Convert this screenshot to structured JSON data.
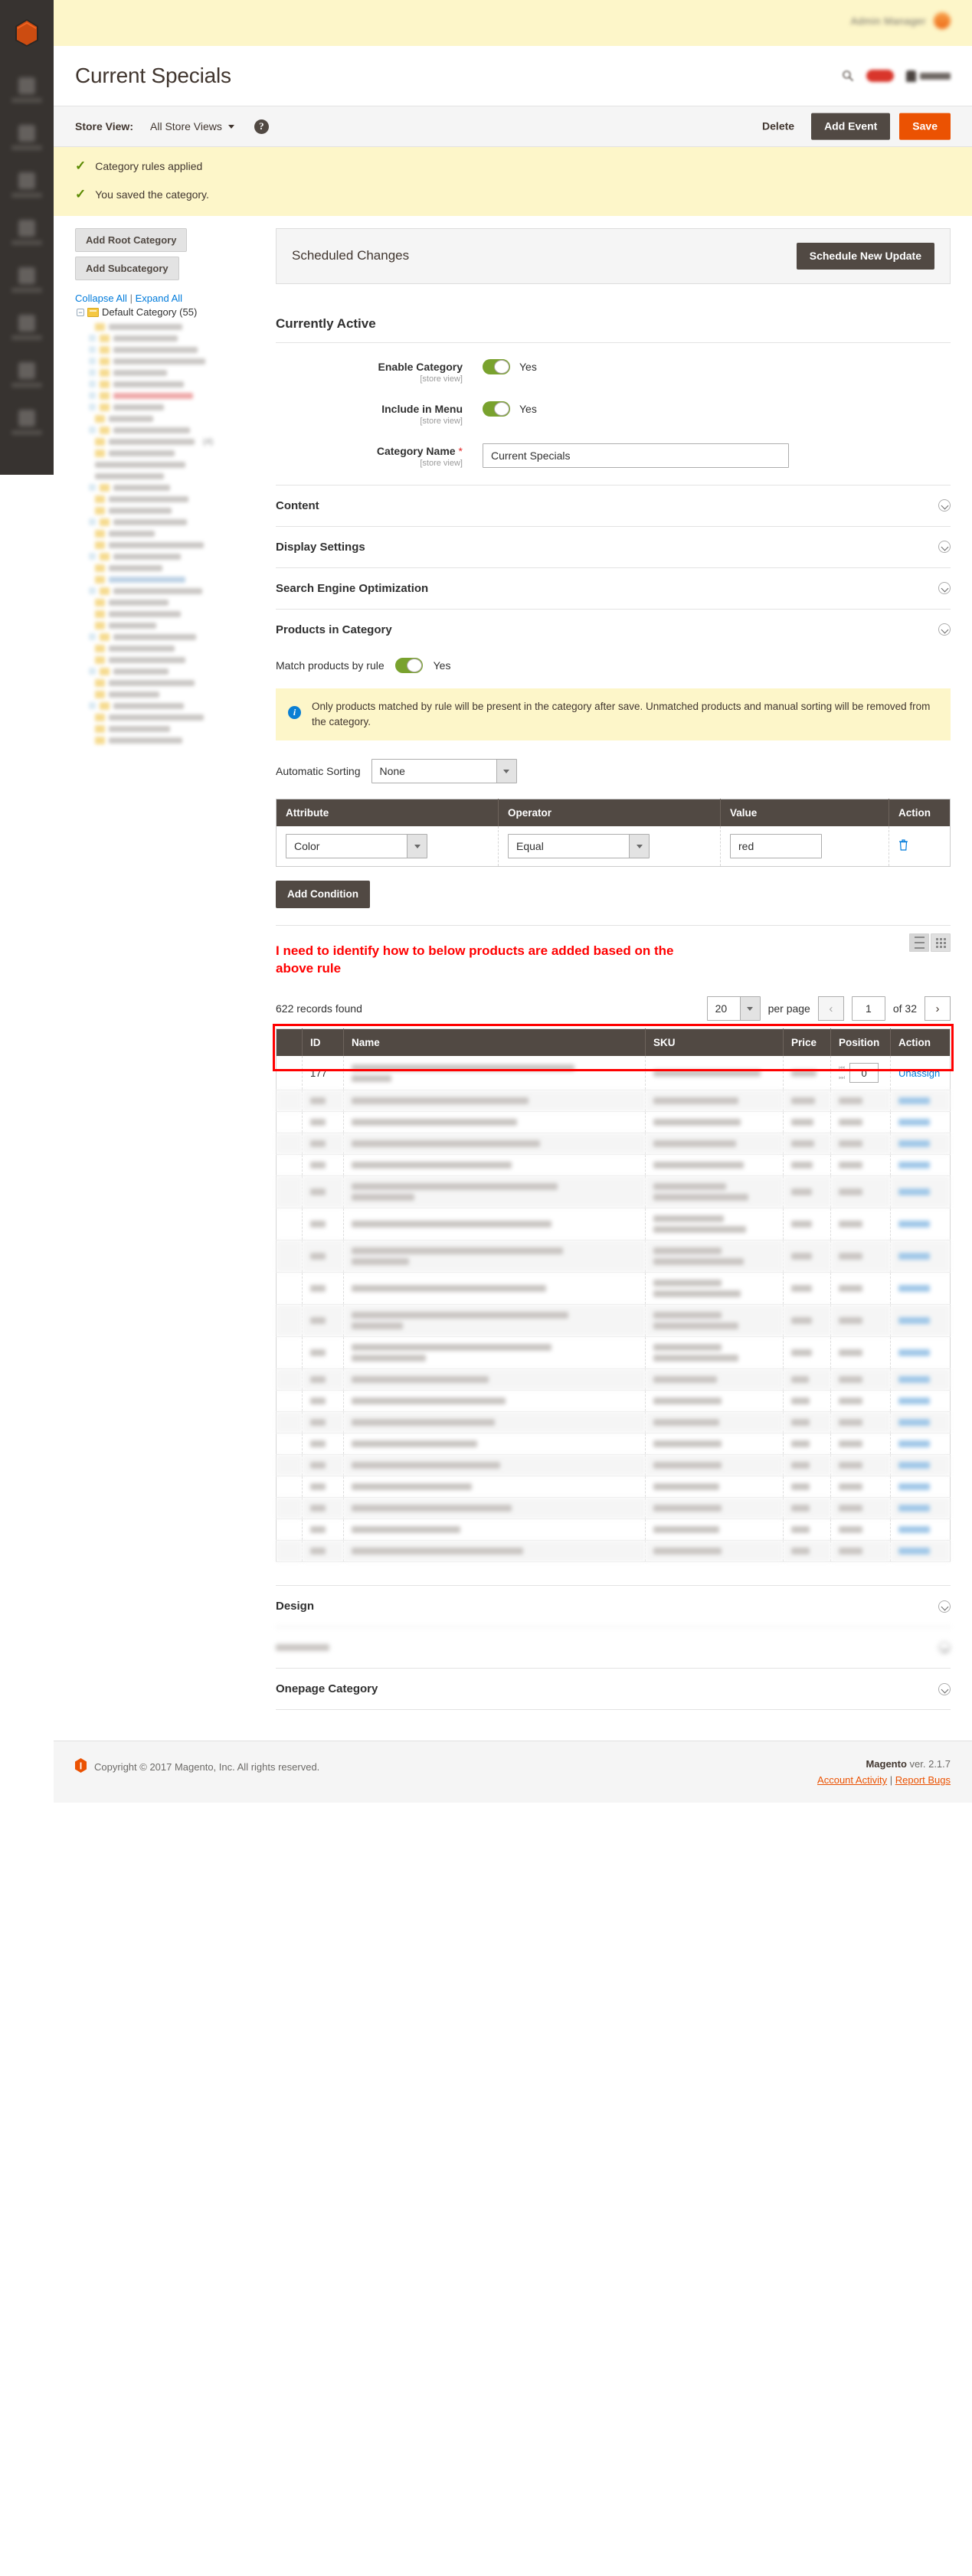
{
  "admin_rail": {
    "logo_name": "magento-logo-icon",
    "items": [
      "dashboard",
      "sales",
      "catalog",
      "customers",
      "marketing",
      "content",
      "reports",
      "stores",
      "system"
    ]
  },
  "header": {
    "user_label": "Admin Manager",
    "search_icon": "search-icon",
    "notification_icon": "notification-bell-icon",
    "user_icon": "user-account-icon"
  },
  "page_title": "Current Specials",
  "storeview": {
    "label": "Store View:",
    "value": "All Store Views",
    "help_glyph": "?",
    "actions": {
      "delete": "Delete",
      "add_event": "Add Event",
      "save": "Save"
    }
  },
  "messages": [
    {
      "icon": "check-icon",
      "text": "Category rules applied"
    },
    {
      "icon": "check-icon",
      "text": "You saved the category."
    }
  ],
  "sidebar": {
    "add_root_category": "Add Root Category",
    "add_subcategory": "Add Subcategory",
    "collapse_all": "Collapse All",
    "expand_all": "Expand All",
    "separator": "|",
    "root_node": "Default Category (55)",
    "hidden_node_count": "(4)"
  },
  "scheduled_changes": {
    "title": "Scheduled Changes",
    "button": "Schedule New Update"
  },
  "currently_active": {
    "title": "Currently Active",
    "fields": [
      {
        "label": "Enable Category",
        "scope": "[store view]",
        "type": "toggle",
        "value": "Yes",
        "on": true
      },
      {
        "label": "Include in Menu",
        "scope": "[store view]",
        "type": "toggle",
        "value": "Yes",
        "on": true
      }
    ],
    "category_name": {
      "label": "Category Name",
      "scope": "[store view]",
      "required": "*",
      "value": "Current Specials",
      "placeholder": ""
    }
  },
  "sections": [
    {
      "label": "Content",
      "expanded": false
    },
    {
      "label": "Display Settings",
      "expanded": false
    },
    {
      "label": "Search Engine Optimization",
      "expanded": false
    },
    {
      "label": "Products in Category",
      "expanded": true
    }
  ],
  "products_in_category": {
    "match_label": "Match products by rule",
    "match_value": "Yes",
    "info_text": "Only products matched by rule will be present in the category after save. Unmatched products and manual sorting will be removed from the category.",
    "info_icon": "info-icon",
    "sorting_label": "Automatic Sorting",
    "sorting_value": "None",
    "conditions": {
      "columns": [
        "Attribute",
        "Operator",
        "Value",
        "Action"
      ],
      "rows": [
        {
          "attribute": "Color",
          "operator": "Equal",
          "value": "red",
          "action_icon": "trash-icon"
        }
      ]
    },
    "add_condition": "Add Condition",
    "annotation": "I need to identify how to below products are added based on the above rule",
    "view_toggle": {
      "list": "list-view-icon",
      "grid": "grid-view-icon",
      "active": "list"
    }
  },
  "pagination": {
    "records_found": "622 records found",
    "per_page_value": "20",
    "per_page_label": "per page",
    "prev_glyph": "‹",
    "next_glyph": "›",
    "page_value": "1",
    "of_label": "of 32"
  },
  "product_grid": {
    "columns": [
      "",
      "ID",
      "Name",
      "SKU",
      "Price",
      "Position",
      "Action"
    ],
    "first_row": {
      "drag_icon": "drag-handle-icon",
      "id": "177",
      "position": "0",
      "action": "Unassign",
      "pos_first_icon": "move-to-first-icon",
      "pos_last_icon": "move-to-last-icon"
    },
    "redacted_row_count": 19
  },
  "bottom_sections": [
    {
      "label": "Design",
      "expanded": false,
      "blurred": false
    },
    {
      "label": "",
      "expanded": false,
      "blurred": true
    },
    {
      "label": "Onepage Category",
      "expanded": false,
      "blurred": false
    }
  ],
  "footer": {
    "logo_icon": "magento-footer-logo-icon",
    "copyright": "Copyright © 2017 Magento, Inc. All rights reserved.",
    "version_brand": "Magento",
    "version_text": " ver. 2.1.7",
    "account_activity": "Account Activity",
    "link_sep": "|",
    "report_bugs": "Report Bugs"
  },
  "colors": {
    "brand_orange": "#eb5202",
    "dark_brown": "#514943",
    "toggle_green": "#79a22e",
    "link_blue": "#007bdb",
    "annotation_red": "#ff0000",
    "message_yellow": "#fdf6c9"
  }
}
